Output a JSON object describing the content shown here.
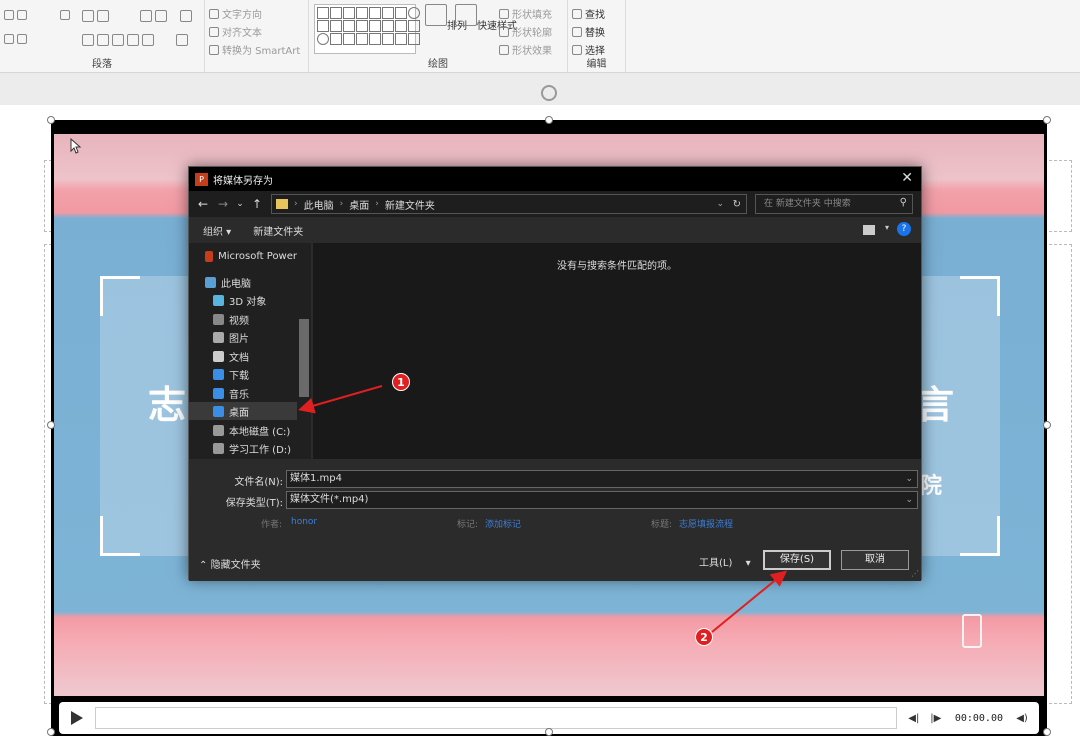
{
  "ribbon": {
    "paragraph_group_label": "段落",
    "text_direction": "文字方向",
    "align_text": "对齐文本",
    "convert_smartart": "转换为 SmartArt",
    "drawing_group_label": "绘图",
    "arrange_label": "排列",
    "quick_styles_label": "快速样式",
    "shape_fill": "形状填充",
    "shape_outline": "形状轮廓",
    "shape_effects": "形状效果",
    "editing_group_label": "编辑",
    "find": "查找",
    "replace": "替换",
    "select": "选择"
  },
  "dialog": {
    "title": "将媒体另存为",
    "close_glyph": "✕",
    "breadcrumbs": [
      "此电脑",
      "桌面",
      "新建文件夹"
    ],
    "search_placeholder": "在 新建文件夹 中搜索",
    "organize": "组织",
    "new_folder": "新建文件夹",
    "help_glyph": "?",
    "nav_items": [
      {
        "label": "Microsoft Power",
        "icon": "powerpoint-icon"
      },
      {
        "label": "此电脑",
        "icon": "this-pc-icon"
      },
      {
        "label": "3D 对象",
        "icon": "3d-objects-icon"
      },
      {
        "label": "视频",
        "icon": "video-icon"
      },
      {
        "label": "图片",
        "icon": "pictures-icon"
      },
      {
        "label": "文档",
        "icon": "documents-icon"
      },
      {
        "label": "下载",
        "icon": "downloads-icon"
      },
      {
        "label": "音乐",
        "icon": "music-icon"
      },
      {
        "label": "桌面",
        "icon": "desktop-icon"
      },
      {
        "label": "本地磁盘 (C:)",
        "icon": "drive-icon"
      },
      {
        "label": "学习工作 (D:)",
        "icon": "drive-icon"
      }
    ],
    "selected_nav_item": "桌面",
    "empty_message": "没有与搜索条件匹配的项。",
    "filename_label": "文件名(N):",
    "filename_value": "媒体1.mp4",
    "filetype_label": "保存类型(T):",
    "filetype_value": "媒体文件(*.mp4)",
    "author_label": "作者:",
    "author_value": "honor",
    "tags_label": "标记:",
    "tags_value": "添加标记",
    "title_label": "标题:",
    "title_value": "志愿填报流程",
    "hide_folders": "隐藏文件夹",
    "tools": "工具(L)",
    "save": "保存(S)",
    "cancel": "取消"
  },
  "video": {
    "visible_chars_left": "志",
    "visible_chars_right": "言",
    "visible_char_lower_right": "院"
  },
  "player": {
    "time": "00:00.00"
  },
  "annotations": {
    "badge_1": "1",
    "badge_2": "2",
    "color": "#e02020"
  },
  "colors": {
    "dialog_bg": "#2b2b2b",
    "video_blue": "#7db4d6",
    "video_pink": "#f09aa3",
    "link_blue": "#3c7ed6"
  }
}
